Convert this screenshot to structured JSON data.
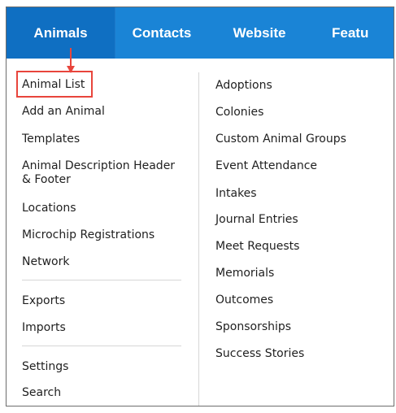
{
  "nav": {
    "tabs": [
      {
        "label": "Animals",
        "active": true
      },
      {
        "label": "Contacts",
        "active": false
      },
      {
        "label": "Website",
        "active": false
      },
      {
        "label": "Featu",
        "active": false
      }
    ]
  },
  "menu": {
    "left": [
      "Animal List",
      "Add an Animal",
      "Templates",
      "Animal Description Header & Footer",
      "Locations",
      "Microchip Registrations",
      "Network",
      "Exports",
      "Imports",
      "Settings",
      "Search"
    ],
    "right": [
      "Adoptions",
      "Colonies",
      "Custom Animal Groups",
      "Event Attendance",
      "Intakes",
      "Journal Entries",
      "Meet Requests",
      "Memorials",
      "Outcomes",
      "Sponsorships",
      "Success Stories"
    ]
  },
  "colors": {
    "nav_bg": "#1a84d6",
    "nav_active": "#0f6fc2",
    "highlight": "#e8453c",
    "arrow": "#e8453c"
  }
}
